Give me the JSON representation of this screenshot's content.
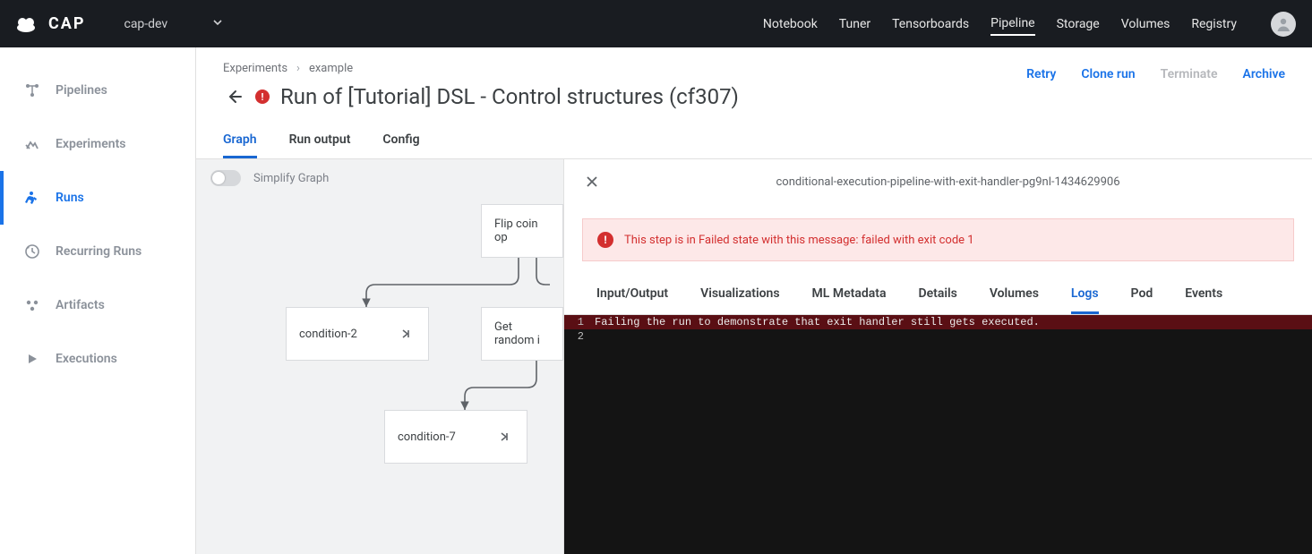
{
  "topnav": {
    "brand": "CAP",
    "project": "cap-dev",
    "items": [
      "Notebook",
      "Tuner",
      "Tensorboards",
      "Pipeline",
      "Storage",
      "Volumes",
      "Registry"
    ],
    "active_index": 3
  },
  "sidebar": {
    "items": [
      {
        "label": "Pipelines"
      },
      {
        "label": "Experiments"
      },
      {
        "label": "Runs"
      },
      {
        "label": "Recurring Runs"
      },
      {
        "label": "Artifacts"
      },
      {
        "label": "Executions"
      }
    ],
    "active_index": 2
  },
  "header": {
    "breadcrumbs": [
      "Experiments",
      "example"
    ],
    "title": "Run of [Tutorial] DSL - Control structures (cf307)",
    "actions": [
      {
        "label": "Retry",
        "disabled": false
      },
      {
        "label": "Clone run",
        "disabled": false
      },
      {
        "label": "Terminate",
        "disabled": true
      },
      {
        "label": "Archive",
        "disabled": false
      }
    ]
  },
  "tabs": {
    "items": [
      "Graph",
      "Run output",
      "Config"
    ],
    "active_index": 0
  },
  "graph": {
    "simplify_label": "Simplify Graph",
    "nodes": {
      "flip": "Flip coin op",
      "cond2": "condition-2",
      "getrand": "Get random i",
      "cond7": "condition-7"
    }
  },
  "details": {
    "title": "conditional-execution-pipeline-with-exit-handler-pg9nl-1434629906",
    "alert": "This step is in Failed state with this message: failed with exit code 1",
    "tabs": [
      "Input/Output",
      "Visualizations",
      "ML Metadata",
      "Details",
      "Volumes",
      "Logs",
      "Pod",
      "Events"
    ],
    "active_tab_index": 5,
    "logs": [
      {
        "n": "1",
        "text": "Failing the run to demonstrate that exit handler still gets executed.",
        "err": true
      },
      {
        "n": "2",
        "text": "",
        "err": false
      }
    ]
  }
}
